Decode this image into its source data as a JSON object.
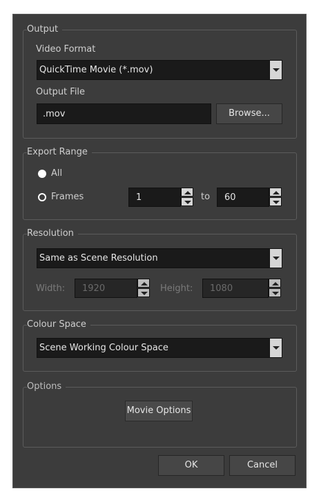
{
  "output": {
    "title": "Output",
    "video_format_label": "Video Format",
    "video_format_value": "QuickTime Movie (*.mov)",
    "output_file_label": "Output File",
    "output_file_value": ".mov",
    "browse_label": "Browse..."
  },
  "export_range": {
    "title": "Export Range",
    "all_label": "All",
    "frames_label": "Frames",
    "selected": "All",
    "from_value": "1",
    "to_label": "to",
    "to_value": "60"
  },
  "resolution": {
    "title": "Resolution",
    "preset_value": "Same as Scene Resolution",
    "width_label": "Width:",
    "width_value": "1920",
    "height_label": "Height:",
    "height_value": "1080"
  },
  "colour_space": {
    "title": "Colour Space",
    "value": "Scene Working Colour Space"
  },
  "options": {
    "title": "Options",
    "movie_options_label": "Movie Options"
  },
  "footer": {
    "ok_label": "OK",
    "cancel_label": "Cancel"
  },
  "colors": {
    "dialog_bg": "#3c3c3c",
    "field_bg": "#1a1a1a",
    "text": "#e6e6e6",
    "disabled_text": "#6a6a6a"
  }
}
